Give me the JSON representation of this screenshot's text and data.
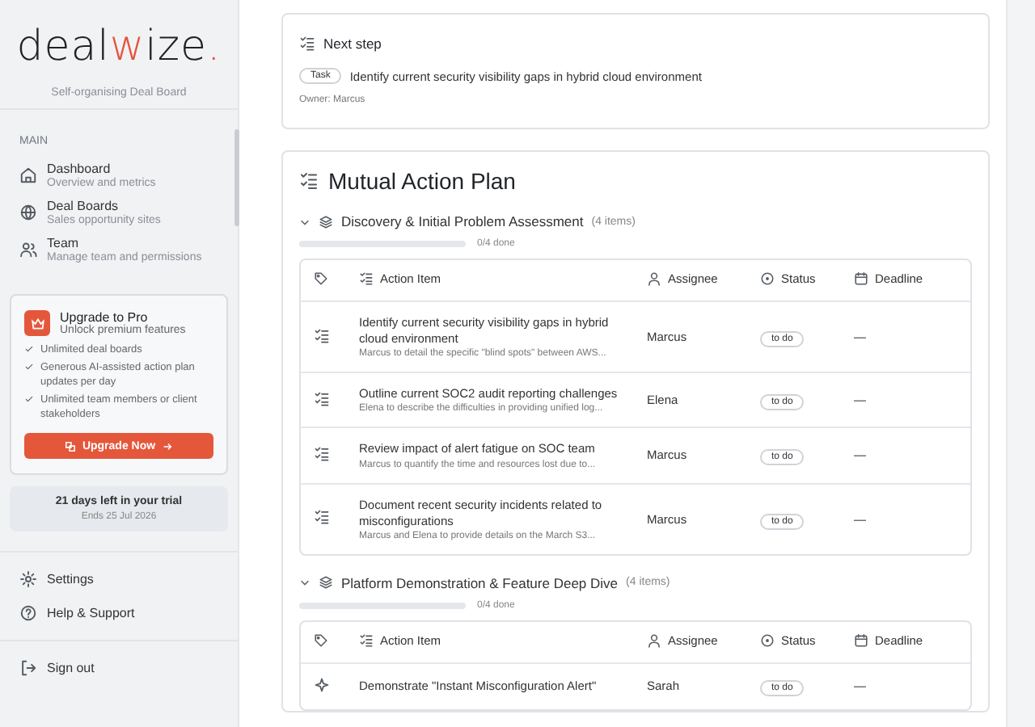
{
  "sidebar": {
    "logo": [
      {
        "text": "deal",
        "accent": false
      },
      {
        "text": "w",
        "accent": true
      },
      {
        "text": "ize",
        "accent": false
      },
      {
        "text": ".",
        "accent": true
      }
    ],
    "tagline": "Self-organising Deal Board",
    "section_label": "MAIN",
    "nav_items": [
      {
        "title": "Dashboard",
        "subtitle": "Overview and metrics",
        "selected": false
      },
      {
        "title": "Deal Boards",
        "subtitle": "Sales opportunity sites",
        "selected": false
      },
      {
        "title": "Team",
        "subtitle": "Manage team and permissions",
        "selected": false
      }
    ],
    "upgrade": {
      "title": "Upgrade to Pro",
      "subtitle": "Unlock premium features",
      "features": [
        "Unlimited deal boards",
        "Generous AI-assisted action plan updates per day",
        "Unlimited team members or client stakeholders"
      ],
      "button": "Upgrade Now"
    },
    "trial": {
      "title": "21 days left in your trial",
      "subtitle": "Ends 25 Jul 2026"
    },
    "footer_items": [
      {
        "label": "Settings"
      },
      {
        "label": "Help & Support"
      }
    ],
    "sign_out": "Sign out"
  },
  "next_step": {
    "title": "Next step",
    "tag": "Task",
    "text": "Identify current security visibility gaps in hybrid cloud environment",
    "owner": "Owner: Marcus"
  },
  "action_plan": {
    "title": "Mutual Action Plan",
    "phases": [
      {
        "title": "Discovery & Initial Problem Assessment",
        "count": "(4 items)",
        "expanded": true,
        "level": 0,
        "progress": "0/4 done",
        "columns": [
          "Action Item",
          "Assignee",
          "Status",
          "Deadline"
        ],
        "rows": [
          {
            "kind": "task",
            "title": "Identify current security visibility gaps in hybrid cloud environment",
            "note": "Marcus to detail the specific \"blind spots\" between AWS...",
            "assignee": "Marcus",
            "status": "to do",
            "deadline": "—"
          },
          {
            "kind": "task",
            "title": "Outline current SOC2 audit reporting challenges",
            "note": "Elena to describe the difficulties in providing unified log...",
            "assignee": "Elena",
            "status": "to do",
            "deadline": "—"
          },
          {
            "kind": "task",
            "title": "Review impact of alert fatigue on SOC team",
            "note": "Marcus to quantify the time and resources lost due to...",
            "assignee": "Marcus",
            "status": "to do",
            "deadline": "—"
          },
          {
            "kind": "task",
            "title": "Document recent security incidents related to misconfigurations",
            "note": "Marcus and Elena to provide details on the March S3...",
            "assignee": "Marcus",
            "status": "to do",
            "deadline": "—"
          }
        ]
      },
      {
        "title": "Platform Demonstration & Feature Deep Dive",
        "count": "(4 items)",
        "expanded": true,
        "level": 0,
        "progress": "0/4 done",
        "columns": [
          "Action Item",
          "Assignee",
          "Status",
          "Deadline"
        ],
        "rows": [
          {
            "kind": "demo",
            "title": "Demonstrate \"Instant Misconfiguration Alert\"",
            "assignee": "Sarah",
            "status": "to do",
            "deadline": "—"
          }
        ]
      }
    ]
  }
}
